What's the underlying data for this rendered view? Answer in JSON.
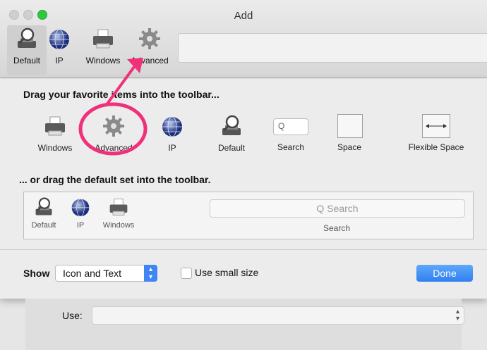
{
  "window": {
    "title": "Add"
  },
  "toolbar": {
    "items": [
      {
        "label": "Default",
        "icon": "printer-magnifier-icon"
      },
      {
        "label": "IP",
        "icon": "globe-icon"
      },
      {
        "label": "Windows",
        "icon": "printer-icon"
      },
      {
        "label": "Advanced",
        "icon": "gear-icon"
      }
    ],
    "selected": "Default"
  },
  "customize": {
    "heading_favorites": "Drag your favorite items into the toolbar...",
    "palette": [
      {
        "label": "Windows",
        "icon": "printer-icon"
      },
      {
        "label": "Advanced",
        "icon": "gear-icon"
      },
      {
        "label": "IP",
        "icon": "globe-icon"
      },
      {
        "label": "Default",
        "icon": "printer-magnifier-icon"
      },
      {
        "label": "Search",
        "icon": "search-field-icon"
      },
      {
        "label": "Space",
        "icon": "space-icon"
      },
      {
        "label": "Flexible Space",
        "icon": "flexible-space-icon"
      }
    ],
    "search_mini_text": "Q",
    "heading_default": "... or drag the default set into the toolbar.",
    "default_set": [
      {
        "label": "Default",
        "icon": "printer-magnifier-icon"
      },
      {
        "label": "IP",
        "icon": "globe-icon"
      },
      {
        "label": "Windows",
        "icon": "printer-icon"
      }
    ],
    "default_search_placeholder": "Q Search",
    "default_search_label": "Search"
  },
  "footer": {
    "show_label": "Show",
    "show_value": "Icon and Text",
    "small_size_label": "Use small size",
    "small_size_checked": false,
    "done_label": "Done"
  },
  "lower_form": {
    "use_label": "Use:",
    "use_value": ""
  },
  "colors": {
    "annotation": "#f0307a",
    "accent": "#3f86f5"
  }
}
